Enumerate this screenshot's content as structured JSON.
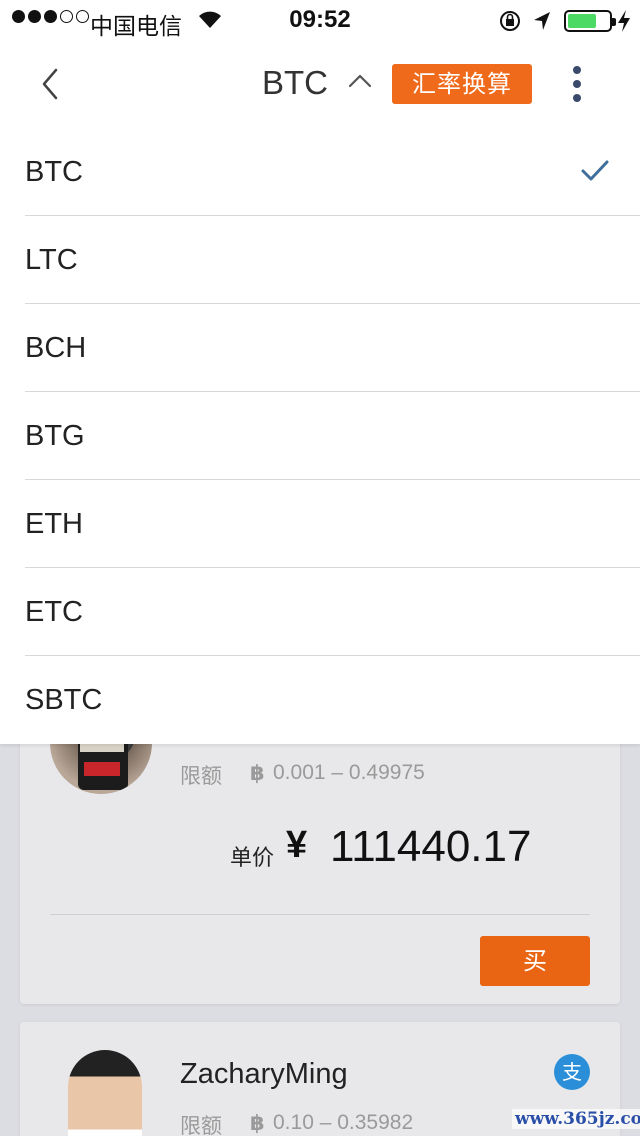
{
  "status_bar": {
    "carrier": "中国电信",
    "time": "09:52",
    "battery_level": 0.7,
    "signal_bars": 3,
    "signal_total": 5
  },
  "nav": {
    "title": "BTC",
    "rate_button": "汇率换算",
    "icons": [
      "back-chevron-icon",
      "caret-up-icon",
      "more-vertical-icon"
    ]
  },
  "dropdown": {
    "selected": "BTC",
    "items": [
      {
        "label": "BTC"
      },
      {
        "label": "LTC"
      },
      {
        "label": "BCH"
      },
      {
        "label": "BTG"
      },
      {
        "label": "ETH"
      },
      {
        "label": "ETC"
      },
      {
        "label": "SBTC"
      }
    ]
  },
  "listings": [
    {
      "username": "",
      "limit_label": "限额",
      "btc_symbol": "฿",
      "limit_range": "0.001 – 0.49975",
      "price_label": "单价",
      "price_currency": "¥",
      "price_value": "111440.17",
      "buy_label": "买"
    },
    {
      "username": "ZacharyMing",
      "pay_badge": "支",
      "limit_label": "限额",
      "btc_symbol": "฿",
      "limit_range": "0.10 – 0.35982"
    }
  ],
  "watermark": "www.365jz.com",
  "colors": {
    "accent_orange": "#f06a1b",
    "check_blue": "#3f6f9a",
    "pay_blue": "#2a8fd8"
  }
}
